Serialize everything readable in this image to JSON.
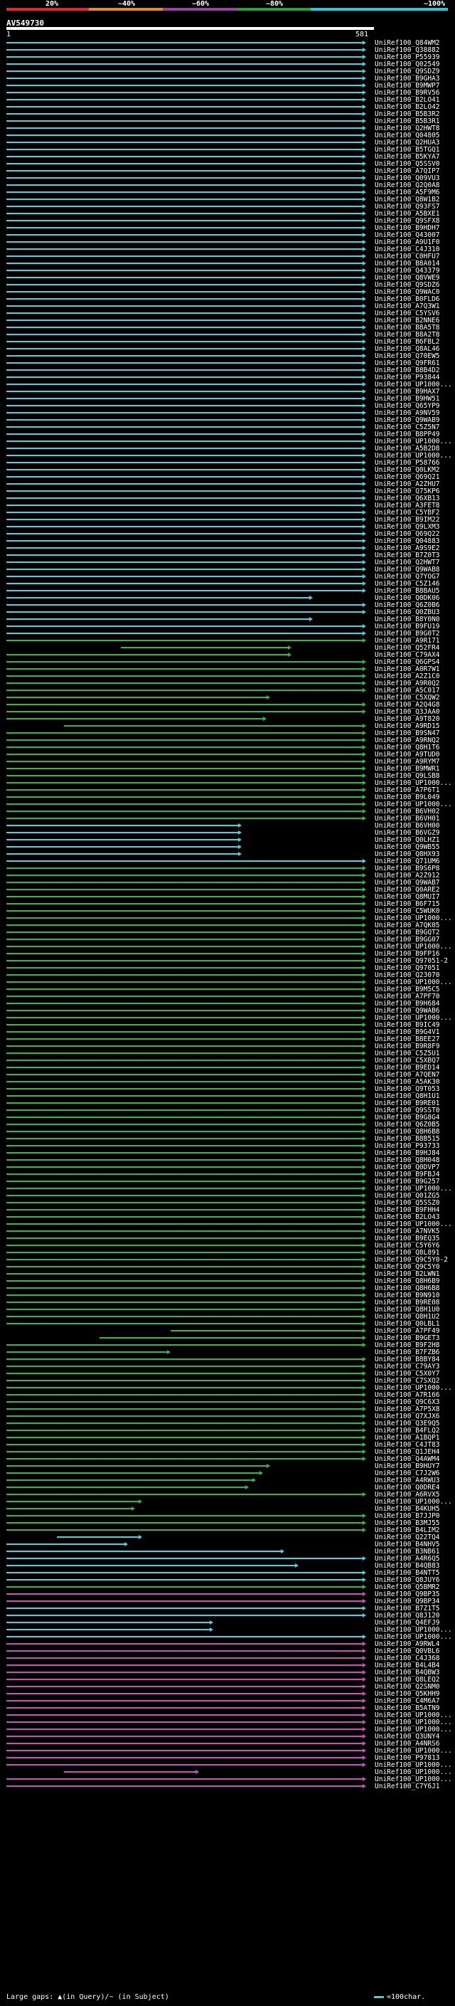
{
  "legend": {
    "labels": [
      "20%",
      "~40%",
      "~60%",
      "~80%",
      "~100%"
    ],
    "colors": [
      "#e8232b",
      "#e88a25",
      "#9c3fa6",
      "#2aa12c",
      "#26c6dc"
    ]
  },
  "query": {
    "id": "AV549730",
    "start": "1",
    "end": "581"
  },
  "colors": {
    "cyan": "#4dd0e1",
    "green": "#35b837",
    "magenta": "#c94fc0"
  },
  "hits": [
    "UniRef100_Q84WM2",
    "UniRef100_Q38882",
    "UniRef100_P55939",
    "UniRef100_Q02549",
    "UniRef100_Q9SDZ9",
    "UniRef100_B9GHA3",
    "UniRef100_B9MWP7",
    "UniRef100_B9RV56",
    "UniRef100_B2LO41",
    "UniRef100_B2LO42",
    "UniRef100_B5B3R2",
    "UniRef100_B5B3R1",
    "UniRef100_Q2HWT8",
    "UniRef100_Q04805",
    "UniRef100_Q2HUA3",
    "UniRef100_B5TGQ1",
    "UniRef100_B5KYA7",
    "UniRef100_Q5SSV0",
    "UniRef100_A7QIP7",
    "UniRef100_Q09VU3",
    "UniRef100_Q2Q0A8",
    "UniRef100_A5F9M6",
    "UniRef100_Q8W1B2",
    "UniRef100_Q93FS7",
    "UniRef100_A5BXE1",
    "UniRef100_Q9SFX8",
    "UniRef100_B9HDH7",
    "UniRef100_Q43007",
    "UniRef100_A9U1F0",
    "UniRef100_C4J310",
    "UniRef100_C0HFU7",
    "UniRef100_B8A014",
    "UniRef100_Q43379",
    "UniRef100_Q8VWE9",
    "UniRef100_Q9SDZ6",
    "UniRef100_Q9WAC0",
    "UniRef100_B0FLD6",
    "UniRef100_A7Q3W1",
    "UniRef100_C5YSV6",
    "UniRef100_B2NNE6",
    "UniRef100_B8A5T8",
    "UniRef100_B8A2T8",
    "UniRef100_B6FBL2",
    "UniRef100_Q8AL46",
    "UniRef100_Q70EW5",
    "UniRef100_Q9FR61",
    "UniRef100_B8B4D2",
    "UniRef100_P93844",
    "UniRef100_UP1000...",
    "UniRef100_B9HAX7",
    "UniRef100_B9HW51",
    "UniRef100_Q65YP9",
    "UniRef100_A9NV59",
    "UniRef100_Q9WAB9",
    "UniRef100_C5Z5N7",
    "UniRef100_B8PP49",
    "UniRef100_UP1000...",
    "UniRef100_A5B2D8",
    "UniRef100_UP1000...",
    "UniRef100_P58766",
    "UniRef100_Q0LKM2",
    "UniRef100_Q69Q21",
    "UniRef100_A2ZHU7",
    "UniRef100_Q75KP6",
    "UniRef100_Q6XB13",
    "UniRef100_A3FET8",
    "UniRef100_C5YBF2",
    "UniRef100_B9IM22",
    "UniRef100_Q9LXM3",
    "UniRef100_Q69Q22",
    "UniRef100_Q04883",
    "UniRef100_A9S9E2",
    "UniRef100_B7Z0T3",
    "UniRef100_Q2HWT7",
    "UniRef100_Q9WAB8",
    "UniRef100_Q7YOG7",
    "UniRef100_C5Z146",
    "UniRef100_B8BAU5",
    "UniRef100_Q0DK06",
    "UniRef100_Q6Z0B6",
    "UniRef100_Q0ZBU3",
    "UniRef100_B8Y0N0",
    "UniRef100_B9FU19",
    "UniRef100_B9G0T2",
    "UniRef100_A9R171",
    "UniRef100_Q52FR4",
    "UniRef100_C79AX4",
    "UniRef100_Q6GPS4",
    "UniRef100_A0R7W1",
    "UniRef100_A2Z1C0",
    "UniRef100_A9R0Q2",
    "UniRef100_A5C017",
    "UniRef100_C5XQW2",
    "UniRef100_A2Q4G8",
    "UniRef100_Q3JAA0",
    "UniRef100_A9T820",
    "UniRef100_A9RD15",
    "UniRef100_B9SN47",
    "UniRef100_A9RNQ2",
    "UniRef100_Q8H1T6",
    "UniRef100_A9TUD0",
    "UniRef100_A9RYM7",
    "UniRef100_B9MWR1",
    "UniRef100_Q9LSB8",
    "UniRef100_UP1000...",
    "UniRef100_A7P6T1",
    "UniRef100_B9L049",
    "UniRef100_UP1000...",
    "UniRef100_B6VH02",
    "UniRef100_B6VH01",
    "UniRef100_B6VH00",
    "UniRef100_B6VGZ9",
    "UniRef100_Q0LHZ1",
    "UniRef100_Q9WB55",
    "UniRef100_Q8HX93",
    "UniRef100_Q71UM6",
    "UniRef100_B9S6P8",
    "UniRef100_A2Z912",
    "UniRef100_Q9WAB7",
    "UniRef100_Q0ARE2",
    "UniRef100_Q8MUI7",
    "UniRef100_B6F715",
    "UniRef100_C5WUK0",
    "UniRef100_UP1000...",
    "UniRef100_A7QK05",
    "UniRef100_B9GQT2",
    "UniRef100_B9GG07",
    "UniRef100_UP1000...",
    "UniRef100_B9FP16",
    "UniRef100_Q97051-2",
    "UniRef100_Q97051",
    "UniRef100_Q23070",
    "UniRef100_UP1000...",
    "UniRef100_B9M5C5",
    "UniRef100_A7PF70",
    "UniRef100_B9H684",
    "UniRef100_Q9WAB6",
    "UniRef100_UP1000...",
    "UniRef100_B9IC49",
    "UniRef100_B9G4V1",
    "UniRef100_B8EE27",
    "UniRef100_B9R8F9",
    "UniRef100_C5Z5U1",
    "UniRef100_C5XBQ7",
    "UniRef100_B9ED14",
    "UniRef100_A7QEN7",
    "UniRef100_A5AK30",
    "UniRef100_Q9T053",
    "UniRef100_Q8H1U1",
    "UniRef100_B9RE01",
    "UniRef100_Q9SST0",
    "UniRef100_B9G8G4",
    "UniRef100_Q6Z0B5",
    "UniRef100_Q8H6B8",
    "UniRef100_B8B515",
    "UniRef100_P93733",
    "UniRef100_B9HJ84",
    "UniRef100_Q8H048",
    "UniRef100_Q0DVP7",
    "UniRef100_B9FBJ4",
    "UniRef100_B9G257",
    "UniRef100_UP1000...",
    "UniRef100_Q01ZG5",
    "UniRef100_Q5SSZ0",
    "UniRef100_B9FHH4",
    "UniRef100_B2LO43",
    "UniRef100_UP1000...",
    "UniRef100_A7NVK5",
    "UniRef100_B9EQ35",
    "UniRef100_C5Y6Y6",
    "UniRef100_Q8L891",
    "UniRef100_Q9C5Y0-2",
    "UniRef100_Q9C5Y0",
    "UniRef100_B2LWN1",
    "UniRef100_Q8H6B9",
    "UniRef100_Q8H6B8",
    "UniRef100_B9N910",
    "UniRef100_B9RE08",
    "UniRef100_Q8H1U0",
    "UniRef100_Q8H1U2",
    "UniRef100_Q0LBL1",
    "UniRef100_A7PF49",
    "UniRef100_B9GET3",
    "UniRef100_B9F2H8",
    "UniRef100_B7FZB6",
    "UniRef100_B8BY84",
    "UniRef100_C79AY3",
    "UniRef100_C5X0Y7",
    "UniRef100_C7SXQ2",
    "UniRef100_UP1000...",
    "UniRef100_A7R166",
    "UniRef100_Q9C6X3",
    "UniRef100_A7P5X8",
    "UniRef100_Q7XJX6",
    "UniRef100_Q3E9Q5",
    "UniRef100_B4FLQ2",
    "UniRef100_A1BQP1",
    "UniRef100_C4JT83",
    "UniRef100_Q1JEH4",
    "UniRef100_Q4AWM4",
    "UniRef100_B9HUY7",
    "UniRef100_C7J2W6",
    "UniRef100_A4RWU3",
    "UniRef100_Q0DRE4",
    "UniRef100_A6RVX5",
    "UniRef100_UP1000...",
    "UniRef100_B4KUH5",
    "UniRef100_B7JJP0",
    "UniRef100_B3MJ55",
    "UniRef100_B4LIM2",
    "UniRef100_Q22TQ4",
    "UniRef100_B4NHV5",
    "UniRef100_B3NB61",
    "UniRef100_A4R6Q5",
    "UniRef100_B4QB83",
    "UniRef100_B4NTT5",
    "UniRef100_Q8JUY6",
    "UniRef100_Q5BMR2",
    "UniRef100_Q9BP35",
    "UniRef100_Q9BP34",
    "UniRef100_B7Z1T5",
    "UniRef100_Q8J120",
    "UniRef100_Q4EFJ9",
    "UniRef100_UP1000...",
    "UniRef100_UP1000...",
    "UniRef100_A9RWL4",
    "UniRef100_Q0VBL6",
    "UniRef100_C4J368",
    "UniRef100_B4L4B4",
    "UniRef100_B4QBW3",
    "UniRef100_Q8LEQ2",
    "UniRef100_Q2SNM0",
    "UniRef100_Q5KHH9",
    "UniRef100_C4M6A7",
    "UniRef100_B5ATN9",
    "UniRef100_UP1000...",
    "UniRef100_UP1000...",
    "UniRef100_UP1000...",
    "UniRef100_Q3UNY4",
    "UniRef100_A4NRS6",
    "UniRef100_UP1000...",
    "UniRef100_P97813",
    "UniRef100_UP1000...",
    "UniRef100_UP1000...",
    "UniRef100_UP1000...",
    "UniRef100_C7Y6J1"
  ],
  "footer": {
    "text": "Large gaps: ▲(in Query)/~ (in Subject)",
    "key": "=100char."
  }
}
